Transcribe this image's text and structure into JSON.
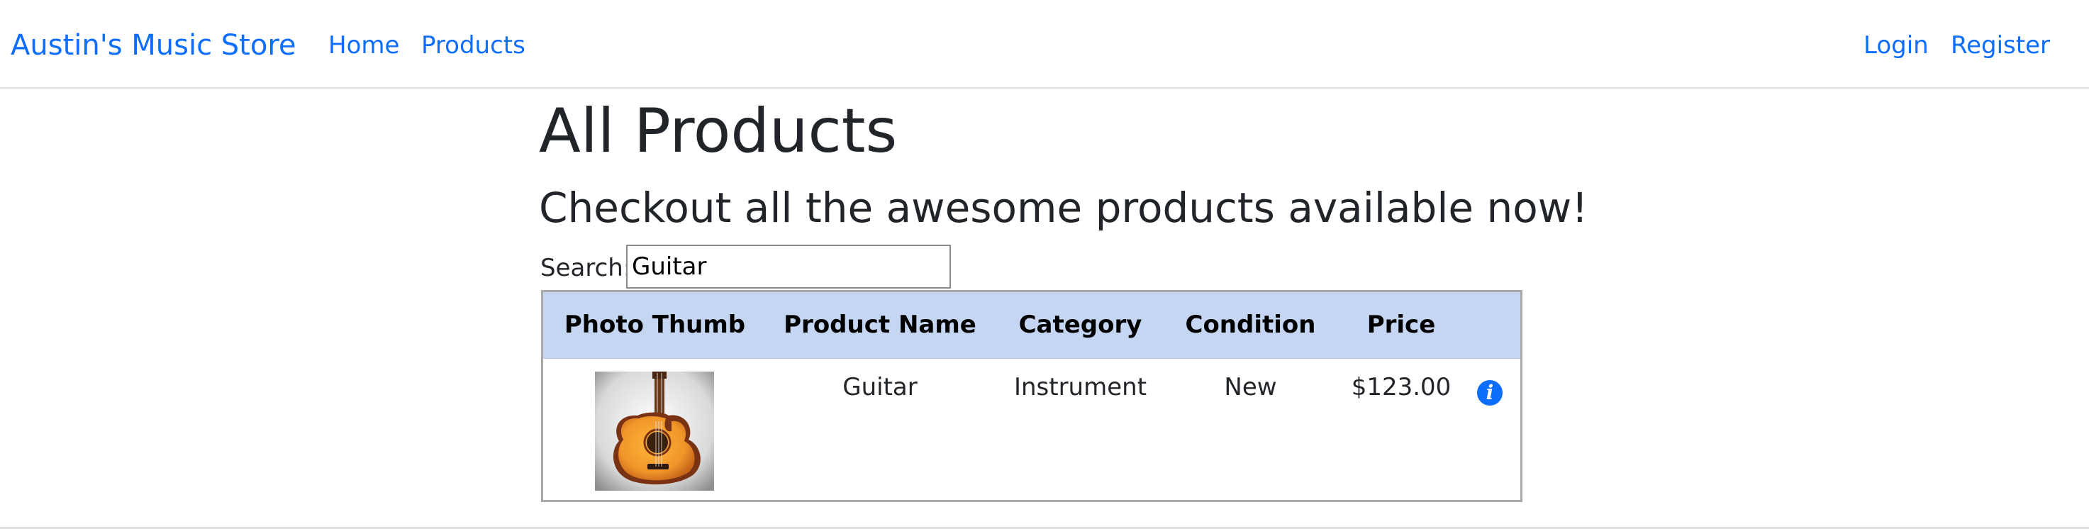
{
  "navbar": {
    "brand": "Austin's Music Store",
    "links": {
      "home": "Home",
      "products": "Products",
      "login": "Login",
      "register": "Register"
    }
  },
  "main": {
    "title": "All Products",
    "subtitle": "Checkout all the awesome products available now!",
    "search": {
      "label": "Search:",
      "value": "Guitar"
    }
  },
  "table": {
    "headers": [
      "Photo Thumb",
      "Product Name",
      "Category",
      "Condition",
      "Price"
    ],
    "rows": [
      {
        "photo_icon": "acoustic-guitar-thumbnail",
        "name": "Guitar",
        "category": "Instrument",
        "condition": "New",
        "price": "$123.00",
        "action_icon": "info-icon"
      }
    ]
  },
  "colors": {
    "accent": "#0d6efd",
    "table_header_bg": "#c5d6f3",
    "text": "#212529"
  }
}
